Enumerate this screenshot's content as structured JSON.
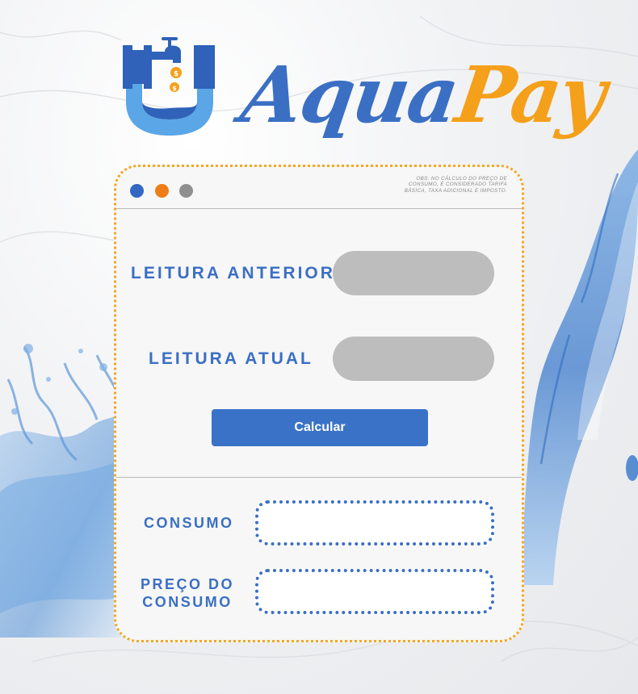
{
  "brand": {
    "name_part1": "Aqua",
    "name_part2": "Pay",
    "primary_color": "#3a6fc4",
    "accent_color": "#f5a01a",
    "logo_icon": "faucet-pipe-coins-icon"
  },
  "window": {
    "controls": [
      "blue-dot",
      "orange-dot",
      "gray-dot"
    ],
    "note": "OBS: NO CÁLCULO DO PREÇO DE CONSUMO, É CONSIDERADO TARIFA BÁSICA, TAXA ADICIONAL E IMPOSTO."
  },
  "form": {
    "leitura_anterior_label": "LEITURA ANTERIOR",
    "leitura_anterior_value": "",
    "leitura_atual_label": "LEITURA ATUAL",
    "leitura_atual_value": "",
    "calcular_label": "Calcular"
  },
  "results": {
    "consumo_label": "CONSUMO",
    "consumo_value": "",
    "preco_label_line1": "PREÇO DO",
    "preco_label_line2": "CONSUMO",
    "preco_value": ""
  }
}
